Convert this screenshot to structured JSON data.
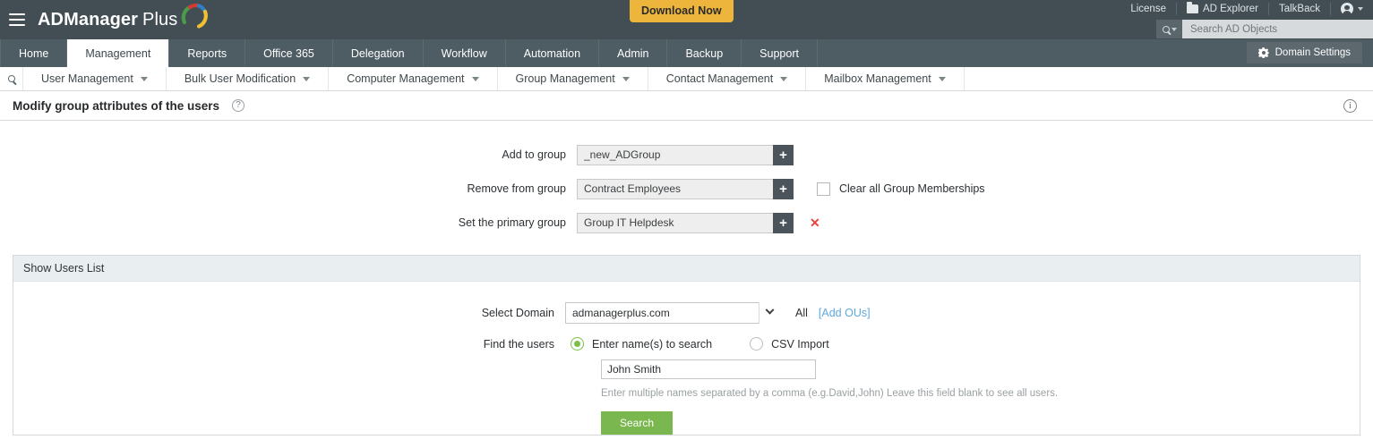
{
  "app": {
    "brand_bold": "ADManager",
    "brand_light": "Plus",
    "download_label": "Download Now"
  },
  "header": {
    "license": "License",
    "ad_explorer": "AD Explorer",
    "talkback": "TalkBack",
    "search_placeholder": "Search AD Objects",
    "search_value": ""
  },
  "tabs": [
    {
      "label": "Home",
      "active": false
    },
    {
      "label": "Management",
      "active": true
    },
    {
      "label": "Reports",
      "active": false
    },
    {
      "label": "Office 365",
      "active": false
    },
    {
      "label": "Delegation",
      "active": false
    },
    {
      "label": "Workflow",
      "active": false
    },
    {
      "label": "Automation",
      "active": false
    },
    {
      "label": "Admin",
      "active": false
    },
    {
      "label": "Backup",
      "active": false
    },
    {
      "label": "Support",
      "active": false
    }
  ],
  "domain_settings_label": "Domain Settings",
  "submenu": [
    {
      "label": "User Management"
    },
    {
      "label": "Bulk User Modification"
    },
    {
      "label": "Computer Management"
    },
    {
      "label": "Group Management"
    },
    {
      "label": "Contact Management"
    },
    {
      "label": "Mailbox Management"
    }
  ],
  "page": {
    "title": "Modify group attributes of the users",
    "help_glyph": "?",
    "info_glyph": "i"
  },
  "form": {
    "rows": [
      {
        "label": "Add to group",
        "value": "_new_ADGroup",
        "plus": "+"
      },
      {
        "label": "Remove from group",
        "value": "Contract Employees",
        "plus": "+"
      },
      {
        "label": "Set the primary group",
        "value": "Group IT Helpdesk",
        "plus": "+"
      }
    ],
    "clear_memberships_label": "Clear all Group Memberships",
    "clear_memberships_checked": false,
    "remove_primary_glyph": "✕"
  },
  "panel": {
    "title": "Show Users List",
    "select_domain_label": "Select Domain",
    "select_domain_value": "admanagerplus.com",
    "all_label": "All",
    "add_ous_label": "[Add OUs]",
    "find_users_label": "Find the users",
    "radio_options": [
      {
        "label": "Enter name(s) to search",
        "selected": true
      },
      {
        "label": "CSV Import",
        "selected": false
      }
    ],
    "name_value": "John Smith",
    "name_placeholder": "",
    "hint": "Enter multiple names separated by a comma (e.g.David,John) Leave this field blank to see all users.",
    "search_button": "Search"
  },
  "colors": {
    "topbar": "#424e54",
    "tabbar": "#4e5c63",
    "accent_yellow": "#edb53c",
    "accent_green": "#7ab74e",
    "link_blue": "#5da9dd",
    "danger_red": "#e8433a"
  }
}
